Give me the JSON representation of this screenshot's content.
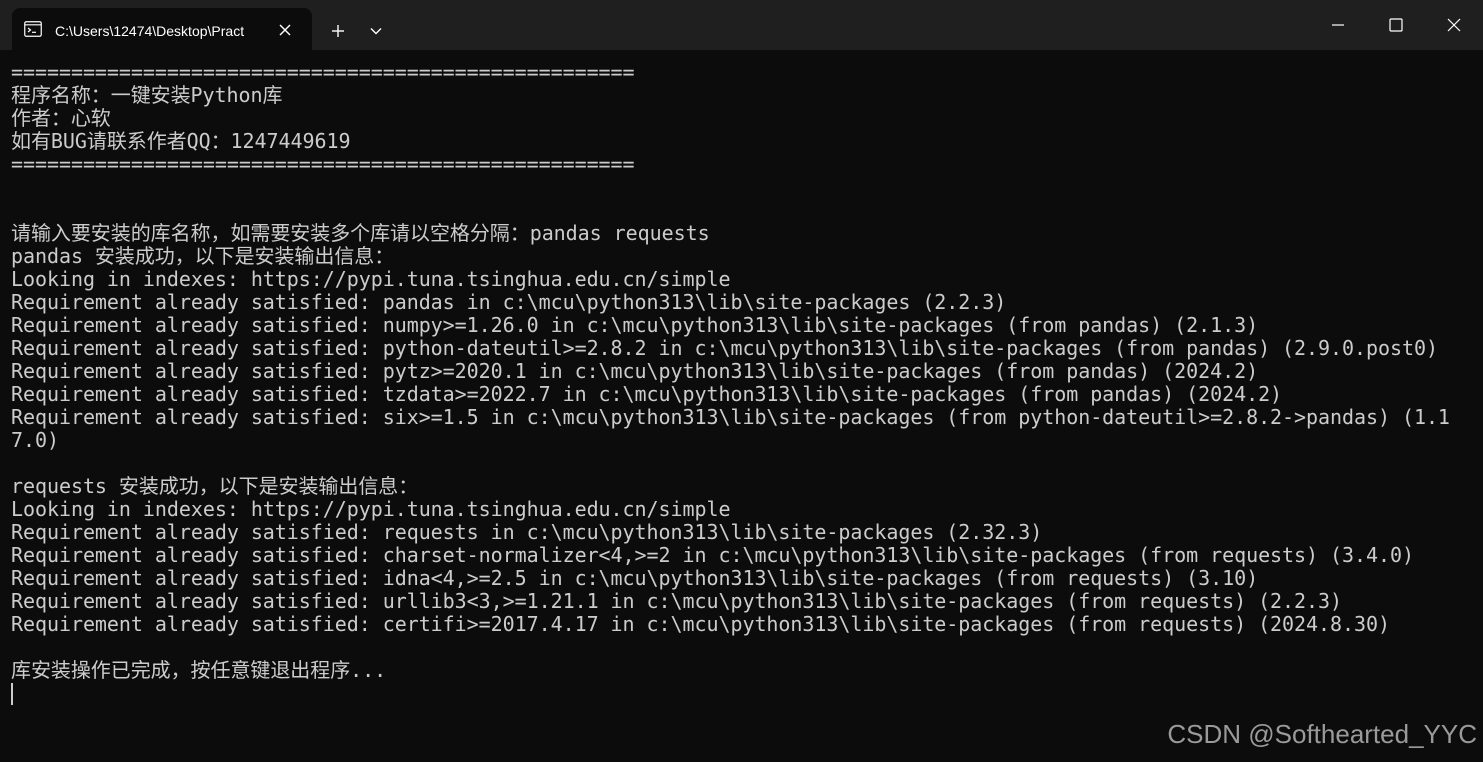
{
  "window": {
    "tab_title": "C:\\Users\\12474\\Desktop\\Pract",
    "icons": {
      "tab": "terminal-icon",
      "close_tab": "close-icon",
      "new_tab": "plus-icon",
      "dropdown": "chevron-down-icon",
      "minimize": "minimize-icon",
      "maximize": "maximize-icon",
      "close_window": "close-icon"
    }
  },
  "terminal": {
    "background": "#0c0c0c",
    "foreground": "#cccccc",
    "lines": [
      "====================================================",
      "程序名称：一键安装Python库",
      "作者：心软",
      "如有BUG请联系作者QQ：1247449619",
      "====================================================",
      "",
      "",
      "请输入要安装的库名称，如需要安装多个库请以空格分隔：pandas requests",
      "pandas 安装成功，以下是安装输出信息：",
      "Looking in indexes: https://pypi.tuna.tsinghua.edu.cn/simple",
      "Requirement already satisfied: pandas in c:\\mcu\\python313\\lib\\site-packages (2.2.3)",
      "Requirement already satisfied: numpy>=1.26.0 in c:\\mcu\\python313\\lib\\site-packages (from pandas) (2.1.3)",
      "Requirement already satisfied: python-dateutil>=2.8.2 in c:\\mcu\\python313\\lib\\site-packages (from pandas) (2.9.0.post0)",
      "Requirement already satisfied: pytz>=2020.1 in c:\\mcu\\python313\\lib\\site-packages (from pandas) (2024.2)",
      "Requirement already satisfied: tzdata>=2022.7 in c:\\mcu\\python313\\lib\\site-packages (from pandas) (2024.2)",
      "Requirement already satisfied: six>=1.5 in c:\\mcu\\python313\\lib\\site-packages (from python-dateutil>=2.8.2->pandas) (1.1",
      "7.0)",
      "",
      "requests 安装成功，以下是安装输出信息：",
      "Looking in indexes: https://pypi.tuna.tsinghua.edu.cn/simple",
      "Requirement already satisfied: requests in c:\\mcu\\python313\\lib\\site-packages (2.32.3)",
      "Requirement already satisfied: charset-normalizer<4,>=2 in c:\\mcu\\python313\\lib\\site-packages (from requests) (3.4.0)",
      "Requirement already satisfied: idna<4,>=2.5 in c:\\mcu\\python313\\lib\\site-packages (from requests) (3.10)",
      "Requirement already satisfied: urllib3<3,>=1.21.1 in c:\\mcu\\python313\\lib\\site-packages (from requests) (2.2.3)",
      "Requirement already satisfied: certifi>=2017.4.17 in c:\\mcu\\python313\\lib\\site-packages (from requests) (2024.8.30)",
      "",
      "库安装操作已完成，按任意键退出程序..."
    ]
  },
  "watermark": "CSDN @Softhearted_YYC"
}
